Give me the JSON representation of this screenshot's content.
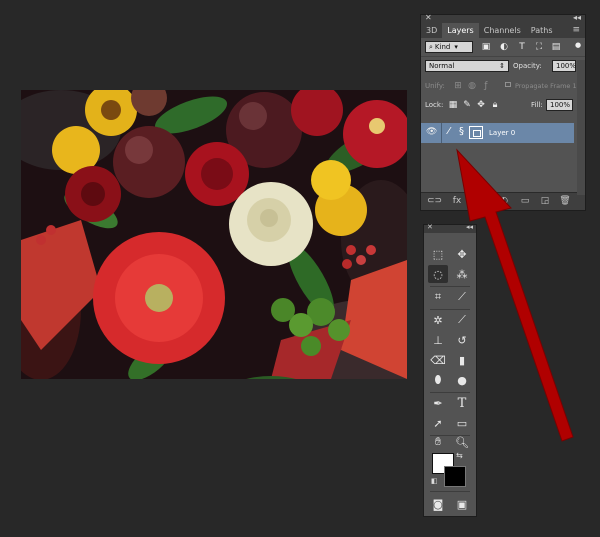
{
  "layers_panel": {
    "tabs": [
      "3D",
      "Layers",
      "Channels",
      "Paths"
    ],
    "active_tab": "Layers",
    "filter_kind": "Kind",
    "blend_mode": "Normal",
    "opacity_label": "Opacity:",
    "opacity_value": "100%",
    "unify_label": "Unify:",
    "propagate_label": "Propagate Frame 1",
    "lock_label": "Lock:",
    "fill_label": "Fill:",
    "fill_value": "100%",
    "layer_name": "Layer 0"
  },
  "toolbox": {
    "tools": [
      "rectangular-marquee-tool",
      "move-tool",
      "lasso-tool",
      "quick-selection-tool",
      "crop-tool",
      "eyedropper-tool",
      "spot-healing-brush-tool",
      "brush-tool",
      "clone-stamp-tool",
      "history-brush-tool",
      "eraser-tool",
      "gradient-tool",
      "blur-tool",
      "dodge-tool",
      "pen-tool",
      "type-tool",
      "path-selection-tool",
      "rectangle-tool",
      "hand-tool",
      "zoom-tool"
    ],
    "selected_tool": "lasso-tool",
    "foreground_color": "#ffffff",
    "background_color": "#000000"
  },
  "colors": {
    "app_background": "#282828",
    "panel_background": "#535353",
    "layer_highlight": "#6b87a8",
    "annotation_arrow": "#b00000"
  }
}
